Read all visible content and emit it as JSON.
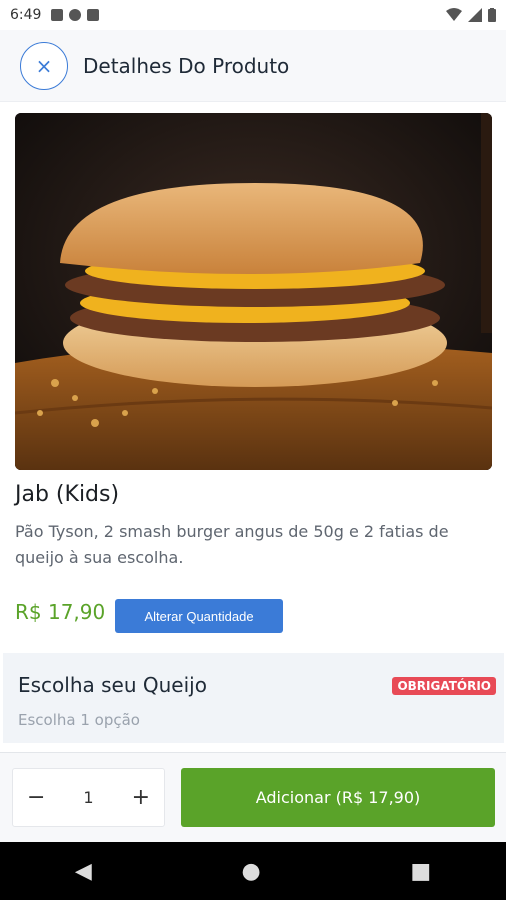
{
  "status_bar": {
    "time": "6:49"
  },
  "header": {
    "title": "Detalhes Do Produto",
    "close_label": "×"
  },
  "product": {
    "name": "Jab (Kids)",
    "description": "Pão Tyson, 2 smash burger angus de 50g e 2 fatias de queijo à sua escolha.",
    "price": "R$ 17,90",
    "change_qty_label": "Alterar Quantidade"
  },
  "option_group": {
    "title": "Escolha seu Queijo",
    "badge": "OBRIGATÓRIO",
    "subtitle": "Escolha 1 opção"
  },
  "footer": {
    "minus": "−",
    "quantity": "1",
    "plus": "+",
    "add_label": "Adicionar (R$ 17,90)"
  },
  "nav": {
    "back": "◀",
    "home": "●",
    "recents": "■"
  },
  "colors": {
    "accent_blue": "#3b7bd7",
    "accent_green": "#5aa329",
    "badge_red": "#e84a56"
  }
}
